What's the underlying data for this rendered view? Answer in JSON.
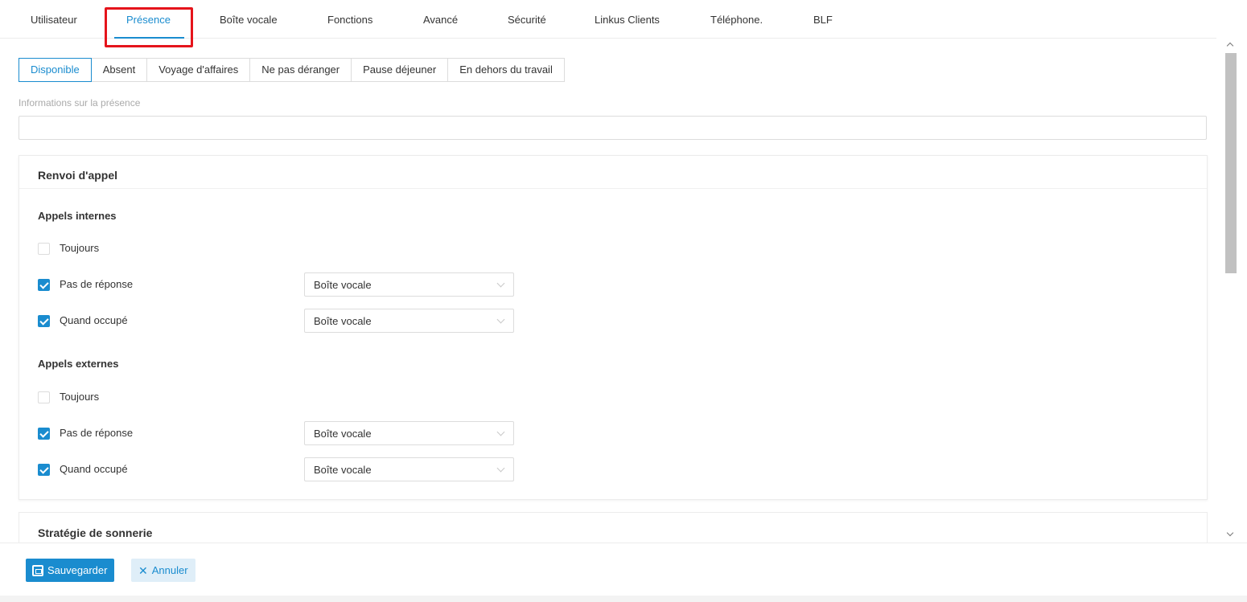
{
  "top_tabs": [
    {
      "label": "Utilisateur"
    },
    {
      "label": "Présence",
      "active": true
    },
    {
      "label": "Boîte vocale"
    },
    {
      "label": "Fonctions"
    },
    {
      "label": "Avancé"
    },
    {
      "label": "Sécurité"
    },
    {
      "label": "Linkus Clients"
    },
    {
      "label": "Téléphone."
    },
    {
      "label": "BLF"
    }
  ],
  "status_tabs": [
    {
      "label": "Disponible",
      "active": true
    },
    {
      "label": "Absent"
    },
    {
      "label": "Voyage d'affaires"
    },
    {
      "label": "Ne pas déranger"
    },
    {
      "label": "Pause déjeuner"
    },
    {
      "label": "En dehors du travail"
    }
  ],
  "presence": {
    "label": "Informations sur la présence",
    "value": ""
  },
  "forwarding": {
    "title": "Renvoi d'appel",
    "internal": {
      "title": "Appels internes",
      "always": {
        "label": "Toujours",
        "checked": false
      },
      "no_answer": {
        "label": "Pas de réponse",
        "checked": true,
        "destination": "Boîte vocale"
      },
      "busy": {
        "label": "Quand occupé",
        "checked": true,
        "destination": "Boîte vocale"
      }
    },
    "external": {
      "title": "Appels externes",
      "always": {
        "label": "Toujours",
        "checked": false
      },
      "no_answer": {
        "label": "Pas de réponse",
        "checked": true,
        "destination": "Boîte vocale"
      },
      "busy": {
        "label": "Quand occupé",
        "checked": true,
        "destination": "Boîte vocale"
      }
    }
  },
  "ring_strategy": {
    "title": "Stratégie de sonnerie"
  },
  "footer": {
    "save_label": "Sauvegarder",
    "cancel_label": "Annuler"
  },
  "colors": {
    "accent": "#1a8ccf",
    "highlight": "#e5141b"
  }
}
